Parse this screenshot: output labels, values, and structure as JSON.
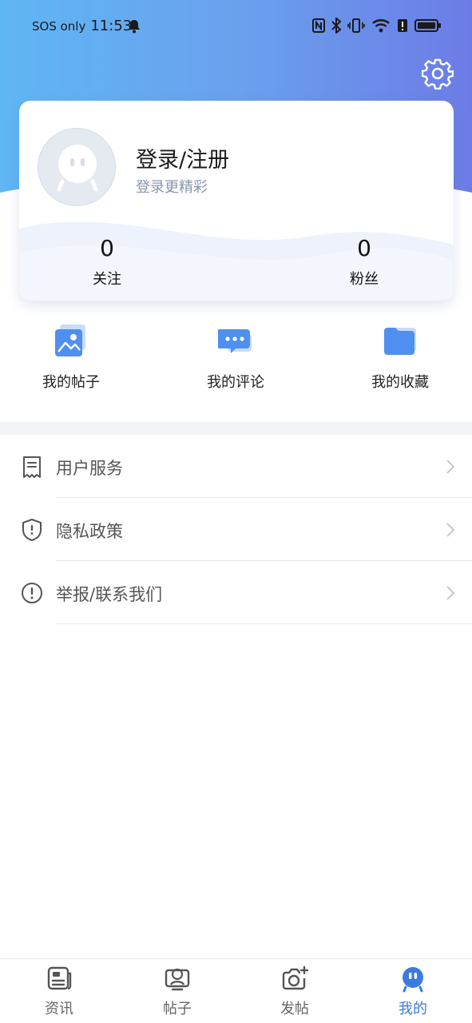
{
  "status_bar": {
    "carrier": "SOS only",
    "time": "11:53"
  },
  "profile": {
    "title": "登录/注册",
    "subtitle": "登录更精彩",
    "following_count": "0",
    "following_label": "关注",
    "fans_count": "0",
    "fans_label": "粉丝"
  },
  "quick_actions": [
    {
      "label": "我的帖子",
      "icon": "image-icon"
    },
    {
      "label": "我的评论",
      "icon": "comment-icon"
    },
    {
      "label": "我的收藏",
      "icon": "folder-icon"
    }
  ],
  "menu": [
    {
      "label": "用户服务",
      "icon": "document-icon"
    },
    {
      "label": "隐私政策",
      "icon": "shield-icon"
    },
    {
      "label": "举报/联系我们",
      "icon": "alert-icon"
    }
  ],
  "tabs": [
    {
      "label": "资讯",
      "icon": "news-icon"
    },
    {
      "label": "帖子",
      "icon": "posts-icon"
    },
    {
      "label": "发帖",
      "icon": "camera-icon"
    },
    {
      "label": "我的",
      "icon": "mine-icon"
    }
  ],
  "colors": {
    "accent": "#3b7be0",
    "header_gradient_start": "#5fb6f5",
    "header_gradient_end": "#6c7ce6"
  }
}
